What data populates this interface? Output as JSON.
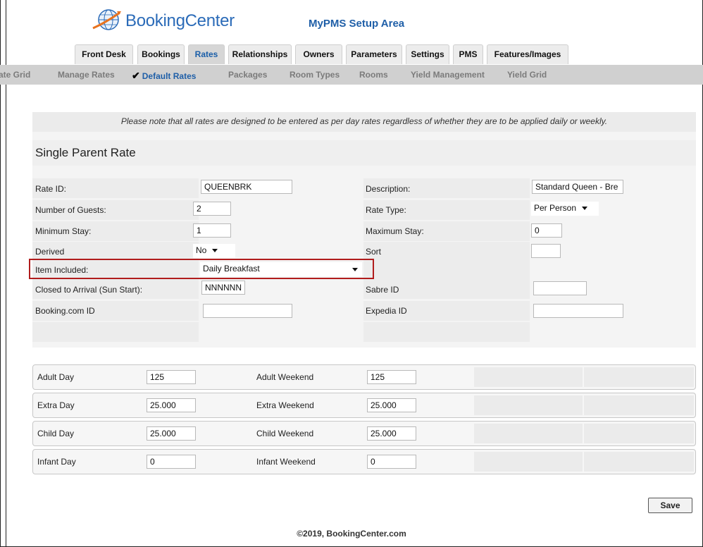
{
  "header": {
    "logo_text": "BookingCenter",
    "app_title": "MyPMS Setup Area"
  },
  "tabs": [
    "Front Desk",
    "Bookings",
    "Rates",
    "Relationships",
    "Owners",
    "Parameters",
    "Settings",
    "PMS",
    "Features/Images"
  ],
  "active_tab": "Rates",
  "subnav": [
    "ate Grid",
    "Manage Rates",
    "Default Rates",
    "Packages",
    "Room Types",
    "Rooms",
    "Yield Management",
    "Yield Grid"
  ],
  "active_subnav": "Default Rates",
  "notice": "Please note that all rates are designed to be entered as per day rates regardless of whether they are to be applied daily or weekly.",
  "rate_title": "Single Parent Rate",
  "form": {
    "rate_id_label": "Rate ID:",
    "rate_id": "QUEENBRK",
    "description_label": "Description:",
    "description": "Standard Queen - Bre",
    "guests_label": "Number of Guests:",
    "guests": "2",
    "rate_type_label": "Rate Type:",
    "rate_type": "Per Person",
    "min_stay_label": "Minimum Stay:",
    "min_stay": "1",
    "max_stay_label": "Maximum Stay:",
    "max_stay": "0",
    "derived_label": "Derived",
    "derived": "No",
    "sort_label": "Sort",
    "sort": "",
    "item_included_label": "Item Included:",
    "item_included": "Daily Breakfast",
    "closed_label": "Closed to Arrival (Sun Start):",
    "closed": "NNNNNN",
    "sabre_label": "Sabre ID",
    "sabre": "",
    "booking_label": "Booking.com ID",
    "booking": "",
    "expedia_label": "Expedia ID",
    "expedia": ""
  },
  "amounts": [
    {
      "day_label": "Adult Day",
      "day": "125",
      "weekend_label": "Adult Weekend",
      "weekend": "125"
    },
    {
      "day_label": "Extra Day",
      "day": "25.000",
      "weekend_label": "Extra Weekend",
      "weekend": "25.000"
    },
    {
      "day_label": "Child Day",
      "day": "25.000",
      "weekend_label": "Child Weekend",
      "weekend": "25.000"
    },
    {
      "day_label": "Infant Day",
      "day": "0",
      "weekend_label": "Infant Weekend",
      "weekend": "0"
    }
  ],
  "save_label": "Save",
  "footer": "©2019, BookingCenter.com",
  "colors": {
    "accent": "#1f5fa8",
    "highlight": "#b11c1c"
  }
}
